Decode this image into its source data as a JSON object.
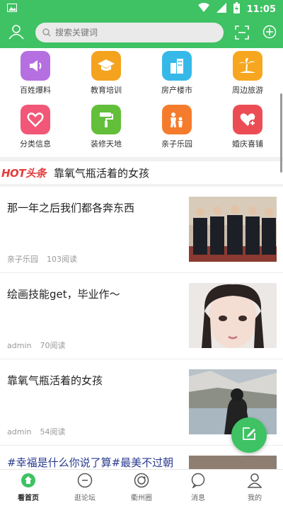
{
  "status": {
    "time": "11:05"
  },
  "search": {
    "placeholder": "搜索关键词"
  },
  "categories": [
    {
      "label": "百姓爆料",
      "icon": "megaphone-icon",
      "color": "#b56fe0"
    },
    {
      "label": "教育培训",
      "icon": "graduation-cap-icon",
      "color": "#f4a31f"
    },
    {
      "label": "房产楼市",
      "icon": "building-icon",
      "color": "#36b9e8"
    },
    {
      "label": "周边旅游",
      "icon": "palm-tree-icon",
      "color": "#f6a71f"
    },
    {
      "label": "分类信息",
      "icon": "heart-icon",
      "color": "#f25777"
    },
    {
      "label": "装修天地",
      "icon": "paint-roller-icon",
      "color": "#63bf3a"
    },
    {
      "label": "亲子乐园",
      "icon": "family-icon",
      "color": "#f57c2c"
    },
    {
      "label": "婚庆喜铺",
      "icon": "heart-plus-icon",
      "color": "#ec4d54"
    }
  ],
  "hot": {
    "logo": "HOT头条",
    "headline": "靠氧气瓶活着的女孩"
  },
  "articles": [
    {
      "title": "那一年之后我们都各奔东西",
      "source": "亲子乐园",
      "reads": "103阅读"
    },
    {
      "title": "绘画技能get，毕业作〜",
      "source": "admin",
      "reads": "70阅读"
    },
    {
      "title": "靠氧气瓶活着的女孩",
      "source": "admin",
      "reads": "54阅读"
    },
    {
      "title": "#幸福是什么你说了算#最美不过朝阳"
    }
  ],
  "tabs": [
    {
      "label": "看首页",
      "icon": "home-icon",
      "active": true
    },
    {
      "label": "逛论坛",
      "icon": "forum-icon"
    },
    {
      "label": "衢州圈",
      "icon": "circle-icon"
    },
    {
      "label": "消息",
      "icon": "message-icon"
    },
    {
      "label": "我的",
      "icon": "user-icon"
    }
  ],
  "colors": {
    "brand": "#3ec263",
    "hot": "#e23d3d"
  }
}
